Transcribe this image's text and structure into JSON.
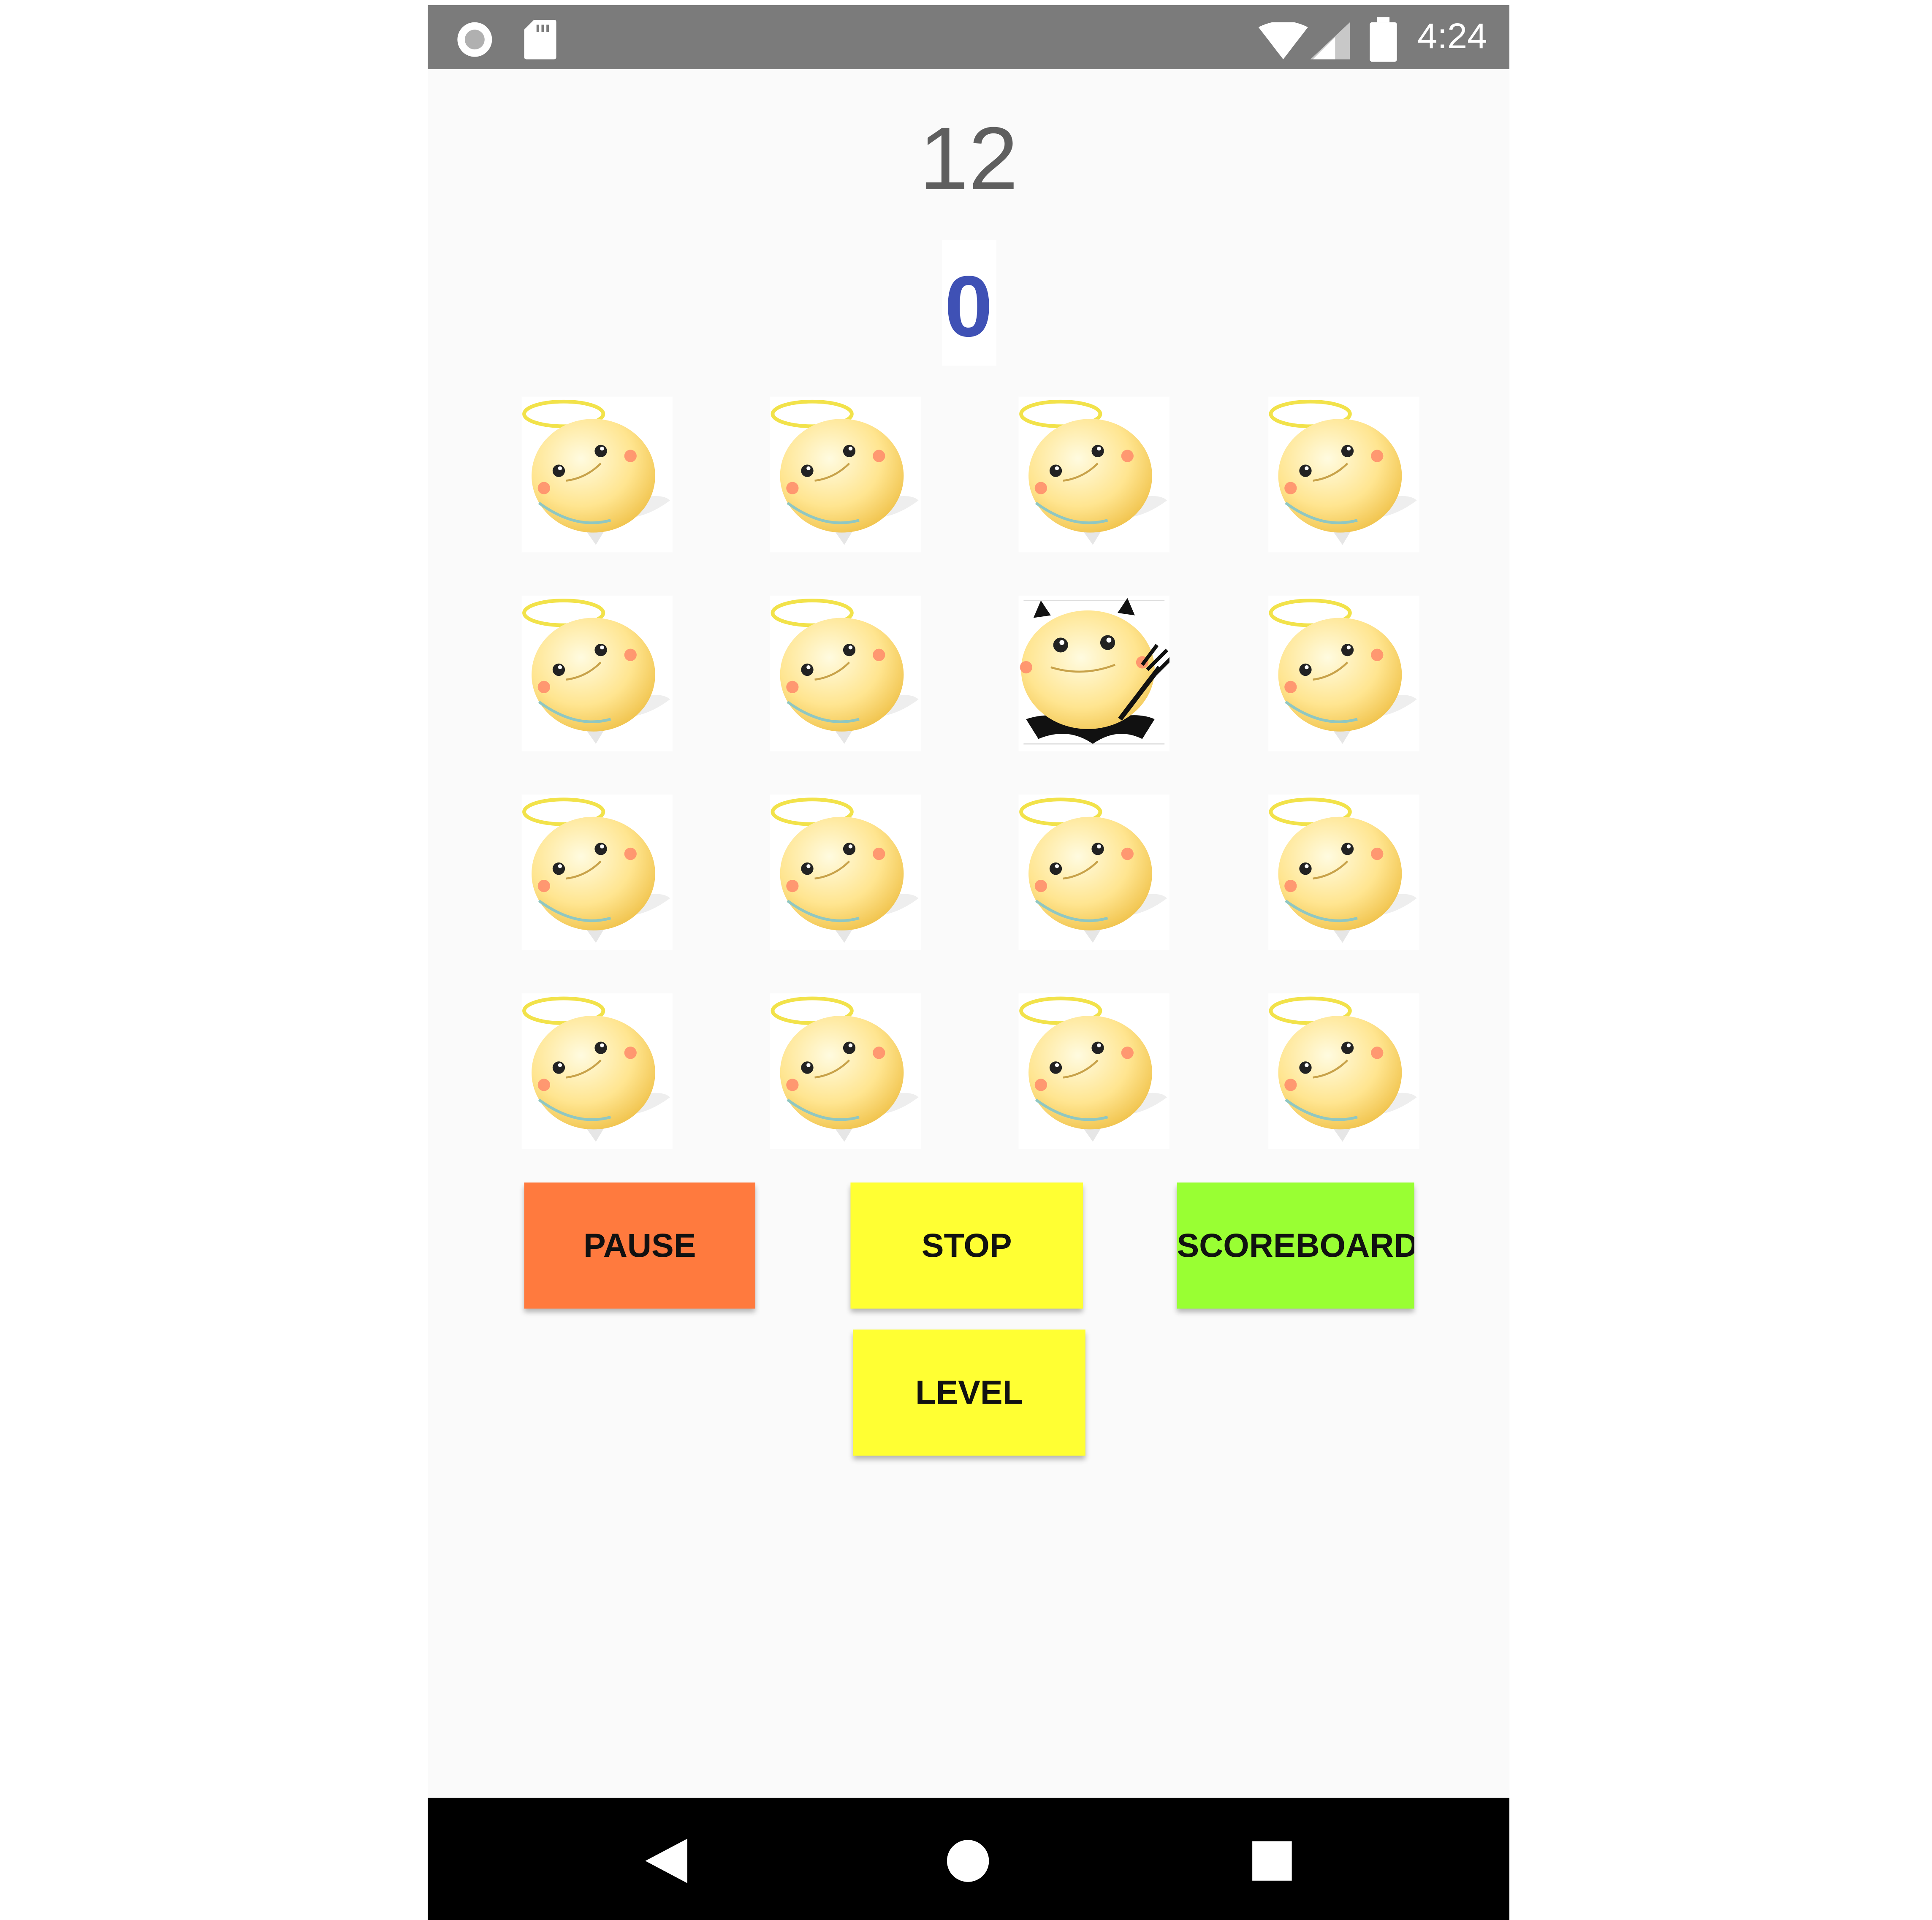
{
  "status_bar": {
    "time": "4:24",
    "left_icons": [
      "circle-notification-icon",
      "sd-card-icon"
    ],
    "right_icons": [
      "wifi-icon",
      "cell-signal-icon",
      "battery-icon"
    ]
  },
  "game": {
    "timer": "12",
    "score": "0",
    "grid": {
      "rows": 4,
      "columns": 4,
      "cells": [
        "angel",
        "angel",
        "angel",
        "angel",
        "angel",
        "angel",
        "devil",
        "angel",
        "angel",
        "angel",
        "angel",
        "angel",
        "angel",
        "angel",
        "angel",
        "angel"
      ]
    }
  },
  "buttons": {
    "pause": "PAUSE",
    "stop": "STOP",
    "scoreboard": "SCOREBOARD",
    "level": "LEVEL"
  },
  "colors": {
    "status_bar": "#7b7b7b",
    "score": "#3f51b5",
    "pause_button": "#ff7a3e",
    "stop_button": "#ffff33",
    "scoreboard_button": "#99ff33",
    "level_button": "#ffff33",
    "nav_bar": "#000000"
  },
  "nav_bar": {
    "icons": [
      "back-icon",
      "home-icon",
      "recents-icon"
    ]
  }
}
